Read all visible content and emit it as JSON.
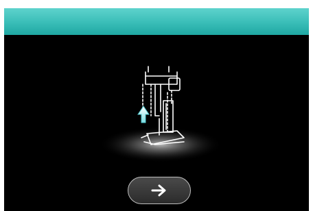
{
  "screen": {
    "header_color": "#3ec2bc",
    "background_color": "#000000"
  },
  "illustration": {
    "subject": "presser-foot-raise-icon",
    "arrow_color": "#8fe3e6",
    "line_color": "#ffffff"
  },
  "navigation": {
    "next_icon": "arrow-right-icon"
  }
}
